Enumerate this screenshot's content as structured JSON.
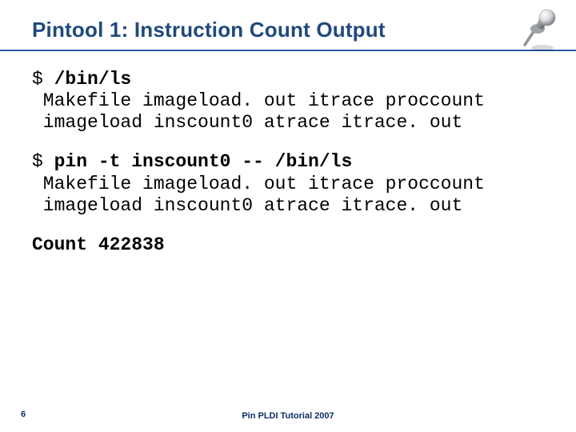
{
  "slide": {
    "title": "Pintool 1: Instruction Count Output",
    "page_number": "6",
    "footer": "Pin PLDI Tutorial 2007"
  },
  "block1": {
    "prompt": "$ ",
    "cmd": "/bin/ls",
    "out1": " Makefile imageload. out itrace proccount",
    "out2": " imageload inscount0 atrace itrace. out"
  },
  "block2": {
    "prompt": "$ ",
    "cmd": "pin -t inscount0 -- /bin/ls",
    "out1": " Makefile imageload. out itrace proccount",
    "out2": " imageload inscount0 atrace itrace. out"
  },
  "count_line": "Count 422838",
  "icons": {
    "pushpin": "pushpin-icon"
  }
}
